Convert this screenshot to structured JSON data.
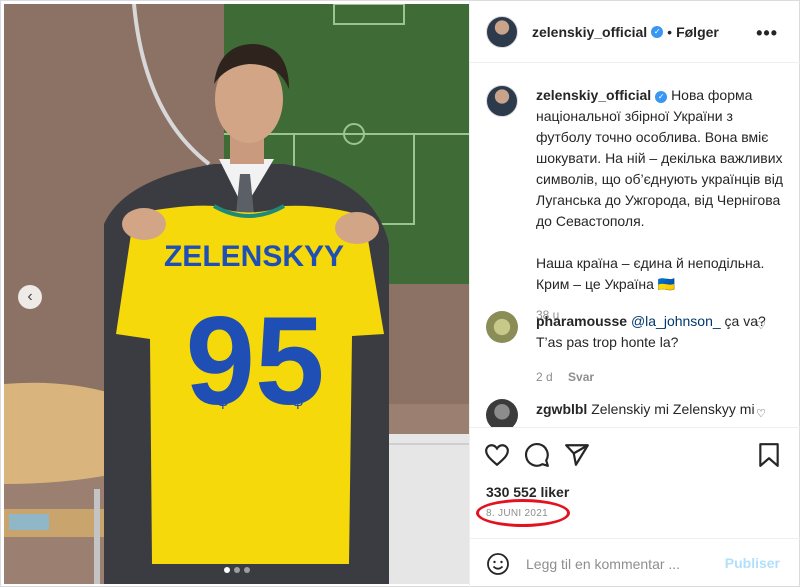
{
  "post": {
    "username": "zelenskiy_official",
    "follow_label": "Følger",
    "separator": "•",
    "more_label": "•••",
    "caption": "Нова форма національної збірної України з футболу точно особлива. Вона вміє шокувати. На ній – декілька важливих символів, що об’єднують українців від Луганська до Ужгорода, від Чернігова до Севастополя.\n\nНаша країна – єдина й неподільна. Крим – це Україна 🇺🇦",
    "caption_age": "38 u"
  },
  "shirt": {
    "name": "ZELENSKYY",
    "number": "95"
  },
  "comments": [
    {
      "username": "pharamousse",
      "mention": "@la_johnson_",
      "text": " ça va? T’as pas trop honte la?",
      "age": "2 d",
      "reply_label": "Svar"
    },
    {
      "username": "zgwblbl",
      "text": "Zelenskiy mi Zelenskyy mi"
    }
  ],
  "actions": {
    "likes": "330 552 liker",
    "date": "8. JUNI 2021"
  },
  "add_comment": {
    "placeholder": "Legg til en kommentar ...",
    "publish_label": "Publiser"
  },
  "colors": {
    "accent": "#3897f0",
    "highlight_circle": "#e3121f",
    "jersey_yellow": "#f5d90a",
    "jersey_blue": "#1f4fb5"
  },
  "carousel": {
    "slides": 3,
    "active": 0
  },
  "icons": [
    "chevron-left-icon",
    "verified-icon",
    "more-icon",
    "heart-icon",
    "comment-icon",
    "share-icon",
    "bookmark-icon",
    "emoji-icon"
  ]
}
